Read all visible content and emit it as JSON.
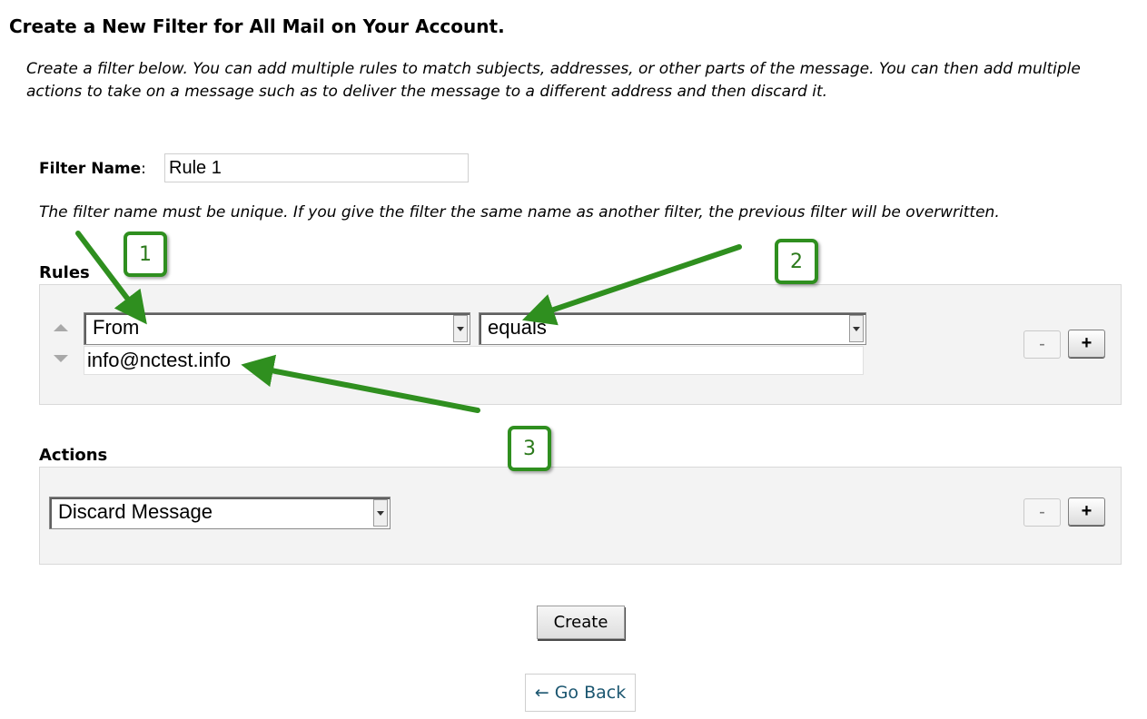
{
  "page": {
    "title": "Create a New Filter for All Mail on Your Account.",
    "intro": "Create a filter below. You can add multiple rules to match subjects, addresses, or other parts of the message. You can then add multiple actions to take on a message such as to deliver the message to a different address and then discard it."
  },
  "filter_name": {
    "label": "Filter Name",
    "colon": ":",
    "value": "Rule 1",
    "hint": "The filter name must be unique. If you give the filter the same name as another filter, the previous filter will be overwritten."
  },
  "rules": {
    "label": "Rules",
    "items": [
      {
        "part": "From",
        "operator": "equals",
        "value": "info@nctest.info"
      }
    ],
    "remove_label": "-",
    "add_label": "+"
  },
  "actions": {
    "label": "Actions",
    "items": [
      {
        "action": "Discard Message"
      }
    ],
    "remove_label": "-",
    "add_label": "+"
  },
  "buttons": {
    "create": "Create",
    "go_back": "← Go Back"
  },
  "annotations": {
    "callouts": [
      "1",
      "2",
      "3"
    ],
    "color": "#2f8f1f"
  }
}
